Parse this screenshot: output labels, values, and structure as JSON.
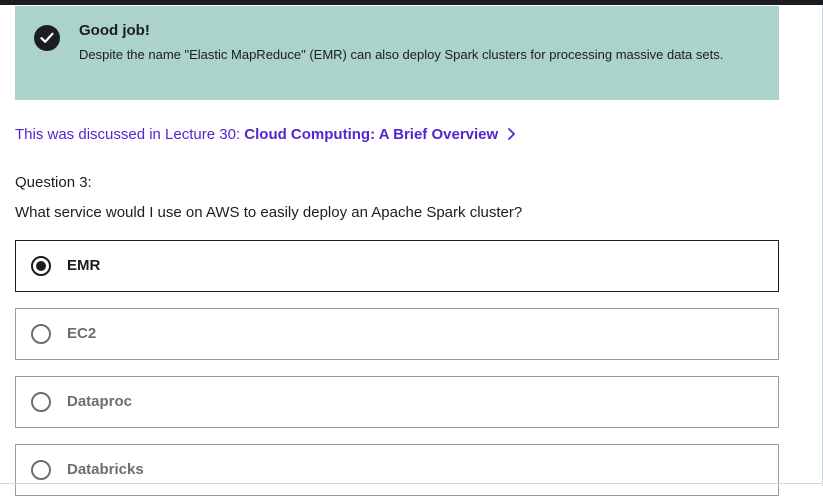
{
  "feedback": {
    "icon": "check-icon",
    "title": "Good job!",
    "message": "Despite the name \"Elastic MapReduce\" (EMR) can also deploy Spark clusters for processing massive data sets.",
    "background": "#acd2cc"
  },
  "lecture_link": {
    "prefix": "This was discussed in Lecture 30: ",
    "title": "Cloud Computing: A Brief Overview",
    "icon": "chevron-right-icon",
    "color": "#5624d0"
  },
  "question": {
    "number": "Question 3:",
    "text": "What service would I use on AWS to easily deploy an Apache Spark cluster?"
  },
  "options": [
    {
      "label": "EMR",
      "selected": true
    },
    {
      "label": "EC2",
      "selected": false
    },
    {
      "label": "Dataproc",
      "selected": false
    },
    {
      "label": "Databricks",
      "selected": false
    }
  ]
}
